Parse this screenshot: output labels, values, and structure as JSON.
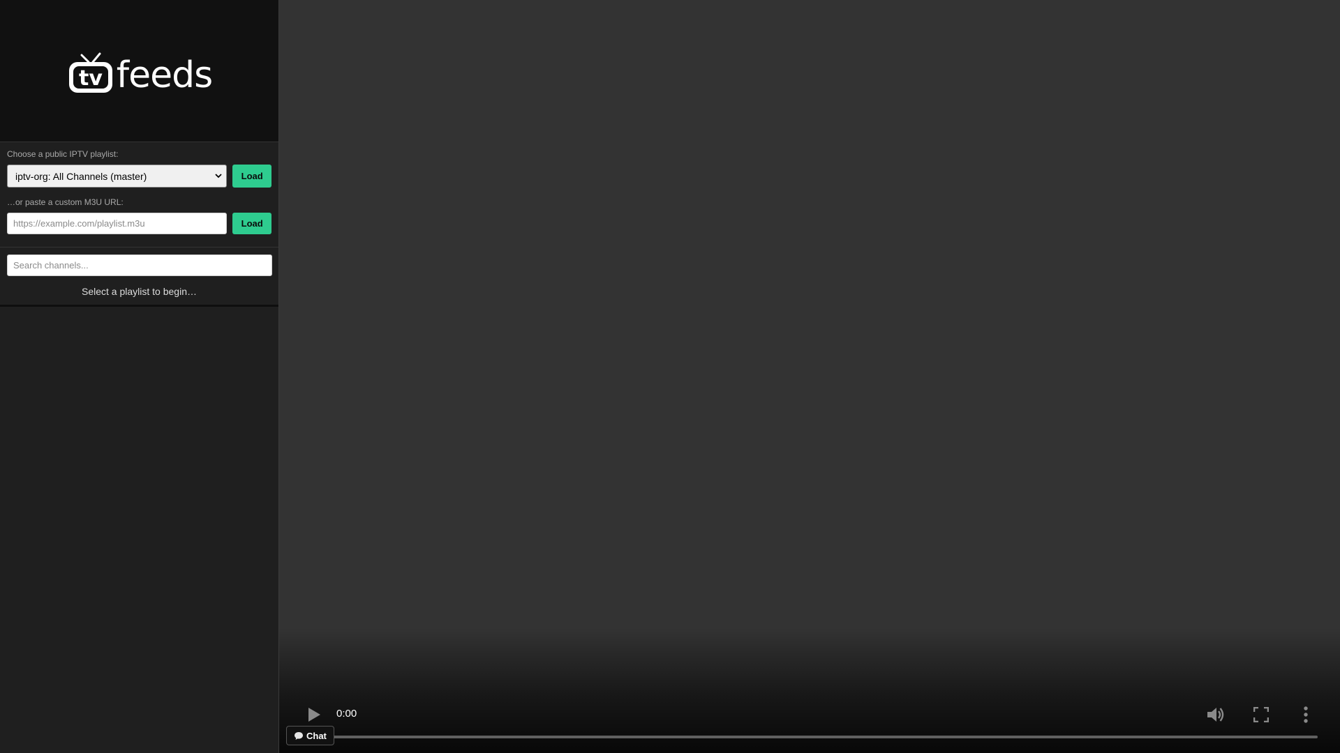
{
  "brand": {
    "logo_badge": "tv",
    "logo_text": "feeds",
    "accent_color": "#2ecc8f"
  },
  "playlist": {
    "choose_label": "Choose a public IPTV playlist:",
    "selected_option": "iptv-org: All Channels (master)",
    "load_label": "Load"
  },
  "custom": {
    "label": "…or paste a custom M3U URL:",
    "placeholder": "https://example.com/playlist.m3u",
    "load_label": "Load"
  },
  "search": {
    "placeholder": "Search channels..."
  },
  "status": {
    "message": "Select a playlist to begin…"
  },
  "player": {
    "time": "0:00",
    "progress": 0,
    "icons": [
      "play-icon",
      "volume-icon",
      "fullscreen-icon",
      "more-vert-icon"
    ]
  },
  "chat": {
    "label": "Chat",
    "icon": "speech-bubble-icon"
  }
}
